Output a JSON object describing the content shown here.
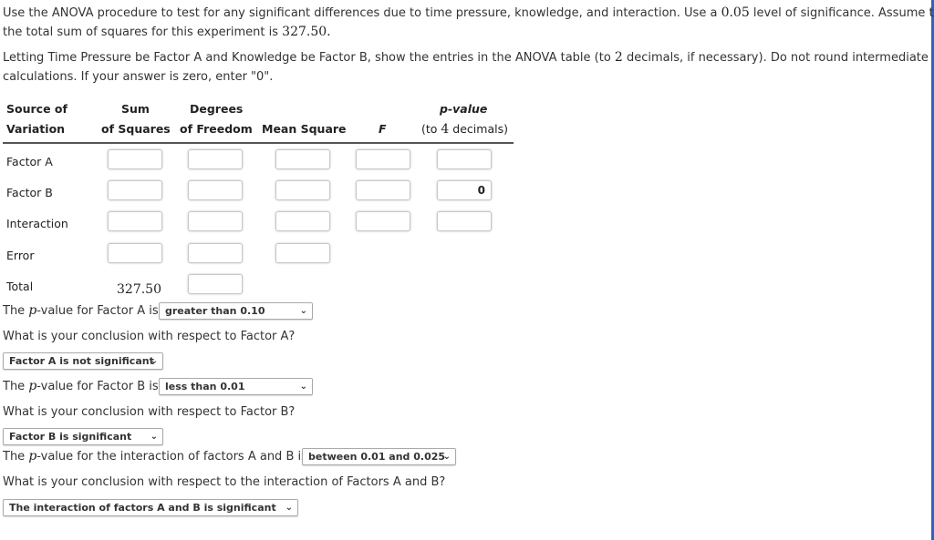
{
  "instructions": {
    "line1_a": "Use the ANOVA procedure to test for any significant differences due to time pressure, knowledge, and interaction. Use a ",
    "alpha": "0.05",
    "line1_b": " level of significance. Assume that",
    "line2_a": "the total sum of squares for this experiment is ",
    "sst": "327.50.",
    "line3_a": "Letting Time Pressure be Factor A and Knowledge be Factor B, show the entries in the ANOVA table (to ",
    "decimals": "2",
    "line3_b": " decimals, if necessary). Do not round intermediate",
    "line4": "calculations. If your answer is zero, enter \"0\"."
  },
  "table": {
    "headers": {
      "source_1": "Source of",
      "source_2": "Variation",
      "ss_1": "Sum",
      "ss_2": "of Squares",
      "df_1": "Degrees",
      "df_2": "of Freedom",
      "ms": "Mean Square",
      "f": "F",
      "p_1": "p-value",
      "p_2a": "(to ",
      "p_2n": "4",
      "p_2b": " decimals)"
    },
    "rows": [
      {
        "label": "Factor A",
        "ss": "",
        "df": "",
        "ms": "",
        "f": "",
        "p": ""
      },
      {
        "label": "Factor B",
        "ss": "",
        "df": "",
        "ms": "",
        "f": "",
        "p": "0"
      },
      {
        "label": "Interaction",
        "ss": "",
        "df": "",
        "ms": "",
        "f": "",
        "p": ""
      },
      {
        "label": "Error",
        "ss": "",
        "df": "",
        "ms": ""
      },
      {
        "label": "Total",
        "ss": "327.50",
        "df": ""
      }
    ]
  },
  "questions": {
    "q1_a": "The ",
    "p_sym": "p",
    "q1_b": "-value for Factor A is",
    "q1_value": "greater than 0.10",
    "q2": "What is your conclusion with respect to Factor A?",
    "q2_value": "Factor A is not significant",
    "q3_b": "-value for Factor B is",
    "q3_value": "less than 0.01",
    "q4": "What is your conclusion with respect to Factor B?",
    "q4_value": "Factor B is significant",
    "q5_b": "-value for the interaction of factors A and B is",
    "q5_value": "between 0.01 and 0.025",
    "q6": "What is your conclusion with respect to the interaction of Factors A and B?",
    "q6_value": "The interaction of factors A and B is significant",
    "chevron": "❯"
  },
  "colors": {
    "accent_bar": "#2a63c4"
  }
}
